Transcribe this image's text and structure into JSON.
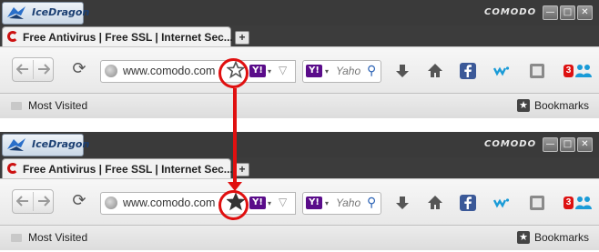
{
  "app": {
    "menu_label": "IceDragon",
    "brand": "COMODO"
  },
  "window_controls": {
    "minimize": "—",
    "maximize": "□",
    "close": "✕"
  },
  "tab": {
    "title": "Free Antivirus | Free SSL | Internet Sec...",
    "new_tab": "+"
  },
  "navigation": {
    "back_icon": "arrow-left-icon",
    "forward_icon": "arrow-right-icon",
    "reload": "⟳"
  },
  "address_bar": {
    "url": "www.comodo.com",
    "site_icon": "globe-icon"
  },
  "search_engine": {
    "badge": "Y!",
    "caret": "▾",
    "dropdown": "▽"
  },
  "search": {
    "badge": "Y!",
    "caret": "▾",
    "placeholder": "Yaho",
    "magnifier": "⚲"
  },
  "toolbar_icons": [
    "download-icon",
    "home-icon",
    "facebook-icon",
    "share-icon",
    "screenshot-icon",
    "notification-icon",
    "people-icon"
  ],
  "notification_count": "3",
  "bookmarks_bar": {
    "most_visited": "Most Visited",
    "bookmarks_label": "Bookmarks",
    "bookmarks_icon": "★"
  },
  "states": [
    {
      "name": "before",
      "star": "empty"
    },
    {
      "name": "after",
      "star": "filled"
    }
  ],
  "colors": {
    "highlight": "#e01010",
    "titlebar": "#3a3a3a",
    "yahoo_purple": "#5a0c8a",
    "facebook_blue": "#3b5998"
  }
}
